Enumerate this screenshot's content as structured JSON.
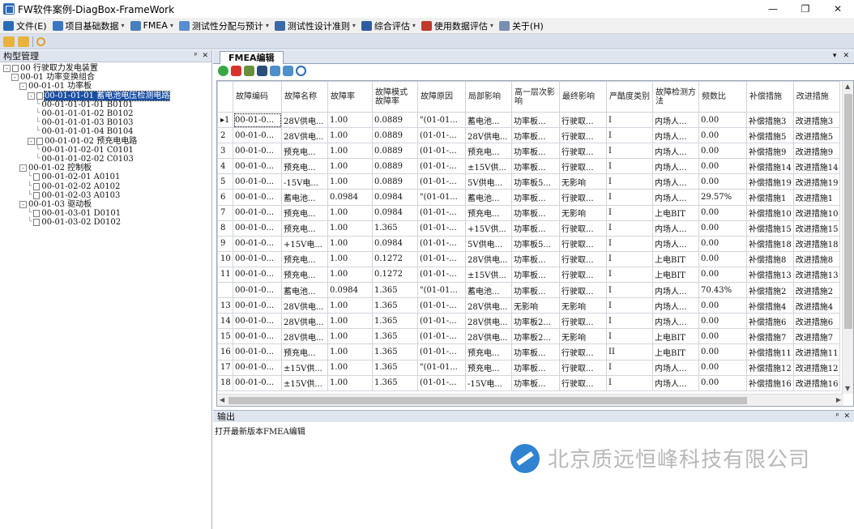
{
  "window": {
    "title": "FW软件案例-DiagBox-FrameWork",
    "controls": [
      "—",
      "❐",
      "✕"
    ]
  },
  "menu": [
    {
      "label": "文件(E)",
      "color": "#2a6bb8",
      "has_arrow": false
    },
    {
      "label": "项目基础数据",
      "color": "#3a78c2",
      "has_arrow": true
    },
    {
      "label": "FMEA",
      "color": "#4a7fbf",
      "has_arrow": true
    },
    {
      "label": "测试性分配与预计",
      "color": "#5a8ccf",
      "has_arrow": true
    },
    {
      "label": "测试性设计准则",
      "color": "#3b6aa8",
      "has_arrow": true
    },
    {
      "label": "综合评估",
      "color": "#2d5d9e",
      "has_arrow": true
    },
    {
      "label": "使用数据评估",
      "color": "#c0392b",
      "has_arrow": true
    },
    {
      "label": "关于(H)",
      "color": "#7a8fb0",
      "has_arrow": false
    }
  ],
  "left_pane": {
    "title": "构型管理",
    "tree": [
      {
        "label": "00 行驶取力发电装置",
        "level": 0,
        "toggle": "-"
      },
      {
        "label": "00-01 功率变换组合",
        "level": 1,
        "toggle": "-"
      },
      {
        "label": "00-01-01 功率板",
        "level": 2,
        "toggle": "-"
      },
      {
        "label": "00-01-01-01 蓄电池电压检测电路",
        "level": 3,
        "toggle": "-",
        "selected": true
      },
      {
        "label": "00-01-01-01-01 B0101",
        "level": 4
      },
      {
        "label": "00-01-01-01-02 B0102",
        "level": 4
      },
      {
        "label": "00-01-01-01-03 B0103",
        "level": 4
      },
      {
        "label": "00-01-01-01-04 B0104",
        "level": 4
      },
      {
        "label": "00-01-01-02 预充电电路",
        "level": 3,
        "toggle": "-"
      },
      {
        "label": "00-01-01-02-01 C0101",
        "level": 4
      },
      {
        "label": "00-01-01-02-02 C0103",
        "level": 4
      },
      {
        "label": "00-01-02 控制板",
        "level": 2,
        "toggle": "-"
      },
      {
        "label": "00-01-02-01 A0101",
        "level": 3
      },
      {
        "label": "00-01-02-02 A0102",
        "level": 3
      },
      {
        "label": "00-01-02-03 A0103",
        "level": 3
      },
      {
        "label": "00-01-03 驱动板",
        "level": 2,
        "toggle": "-"
      },
      {
        "label": "00-01-03-01 D0101",
        "level": 3
      },
      {
        "label": "00-01-03-02 D0102",
        "level": 3
      }
    ]
  },
  "editor": {
    "tab_label": "FMEA编辑",
    "columns": [
      "故障编码",
      "故障名称",
      "故障率",
      "故障模式故障率",
      "故障原因",
      "局部影响",
      "高一层次影响",
      "最终影响",
      "严酷度类别",
      "故障检测方法",
      "频数比",
      "补偿措施",
      "改进措施"
    ],
    "rows": [
      {
        "idx": "1",
        "cells": [
          "00-01-0...",
          "28V供电...",
          "1.00",
          "0.0889",
          "\"(01-01...",
          "蓄电池...",
          "功率板...",
          "行驶取...",
          "I",
          "内场人...",
          "0.00",
          "补偿措施3",
          "改进措施3"
        ]
      },
      {
        "idx": "2",
        "cells": [
          "00-01-0...",
          "28V供电...",
          "1.00",
          "0.0889",
          "(01-01-...",
          "28V供电...",
          "功率板...",
          "行驶取...",
          "I",
          "内场人...",
          "0.00",
          "补偿措施5",
          "改进措施5"
        ]
      },
      {
        "idx": "3",
        "cells": [
          "00-01-0...",
          "预充电...",
          "1.00",
          "0.0889",
          "(01-01-...",
          "预充电...",
          "功率板...",
          "行驶取...",
          "I",
          "内场人...",
          "0.00",
          "补偿措施9",
          "改进措施9"
        ]
      },
      {
        "idx": "4",
        "cells": [
          "00-01-0...",
          "预充电...",
          "1.00",
          "0.0889",
          "(01-01-...",
          "±15V供...",
          "功率板...",
          "行驶取...",
          "I",
          "内场人...",
          "0.00",
          "补偿措施14",
          "改进措施14"
        ]
      },
      {
        "idx": "5",
        "cells": [
          "00-01-0...",
          "-15V电...",
          "1.00",
          "0.0889",
          "(01-01-...",
          "5V供电...",
          "功率板5...",
          "无影响",
          "I",
          "内场人...",
          "0.00",
          "补偿措施19",
          "改进措施19"
        ]
      },
      {
        "idx": "6",
        "cells": [
          "00-01-0...",
          "蓄电池...",
          "0.0984",
          "0.0984",
          "\"(01-01...",
          "蓄电池...",
          "功率板...",
          "行驶取...",
          "I",
          "内场人...",
          "29.57%",
          "补偿措施1",
          "改进措施1"
        ]
      },
      {
        "idx": "7",
        "cells": [
          "00-01-0...",
          "预充电...",
          "1.00",
          "0.0984",
          "(01-01-...",
          "预充电...",
          "功率板...",
          "无影响",
          "I",
          "上电BIT",
          "0.00",
          "补偿措施10",
          "改进措施10"
        ]
      },
      {
        "idx": "8",
        "cells": [
          "00-01-0...",
          "预充电...",
          "1.00",
          "1.365",
          "(01-01-...",
          "+15V供...",
          "功率板...",
          "行驶取...",
          "I",
          "内场人...",
          "0.00",
          "补偿措施15",
          "改进措施15"
        ]
      },
      {
        "idx": "9",
        "cells": [
          "00-01-0...",
          "+15V电...",
          "1.00",
          "0.0984",
          "(01-01-...",
          "5V供电...",
          "功率板5...",
          "行驶取...",
          "I",
          "内场人...",
          "0.00",
          "补偿措施18",
          "改进措施18"
        ]
      },
      {
        "idx": "10",
        "cells": [
          "00-01-0...",
          "预充电...",
          "1.00",
          "0.1272",
          "(01-01-...",
          "28V供电...",
          "功率板...",
          "行驶取...",
          "I",
          "上电BIT",
          "0.00",
          "补偿措施8",
          "改进措施8"
        ]
      },
      {
        "idx": "11",
        "cells": [
          "00-01-0...",
          "预充电...",
          "1.00",
          "0.1272",
          "(01-01-...",
          "±15V供...",
          "功率板...",
          "行驶取...",
          "I",
          "上电BIT",
          "0.00",
          "补偿措施13",
          "改进措施13"
        ]
      },
      {
        "idx": "",
        "cells": [
          "00-01-0...",
          "蓄电池...",
          "0.0984",
          "1.365",
          "\"(01-01...",
          "蓄电池...",
          "功率板...",
          "行驶取...",
          "I",
          "内场人...",
          "70.43%",
          "补偿措施2",
          "改进措施2"
        ]
      },
      {
        "idx": "13",
        "cells": [
          "00-01-0...",
          "28V供电...",
          "1.00",
          "1.365",
          "(01-01-...",
          "28V供电...",
          "无影响",
          "无影响",
          "I",
          "内场人...",
          "0.00",
          "补偿措施4",
          "改进措施4"
        ]
      },
      {
        "idx": "14",
        "cells": [
          "00-01-0...",
          "28V供电...",
          "1.00",
          "1.365",
          "(01-01-...",
          "28V供电...",
          "功率板2...",
          "行驶取...",
          "I",
          "内场人...",
          "0.00",
          "补偿措施6",
          "改进措施6"
        ]
      },
      {
        "idx": "15",
        "cells": [
          "00-01-0...",
          "28V供电...",
          "1.00",
          "1.365",
          "(01-01-...",
          "28V供电...",
          "功率板2...",
          "无影响",
          "I",
          "上电BIT",
          "0.00",
          "补偿措施7",
          "改进措施7"
        ]
      },
      {
        "idx": "16",
        "cells": [
          "00-01-0...",
          "预充电...",
          "1.00",
          "1.365",
          "(01-01-...",
          "预充电...",
          "功率板...",
          "行驶取...",
          "II",
          "上电BIT",
          "0.00",
          "补偿措施11",
          "改进措施11"
        ]
      },
      {
        "idx": "17",
        "cells": [
          "00-01-0...",
          "±15V供...",
          "1.00",
          "1.365",
          "\"(01-01...",
          "预充电...",
          "功率板...",
          "行驶取...",
          "I",
          "内场人...",
          "0.00",
          "补偿措施12",
          "改进措施12"
        ]
      },
      {
        "idx": "18",
        "cells": [
          "00-01-0...",
          "±15V供...",
          "1.00",
          "1.365",
          "(01-01-...",
          "-15V电...",
          "功率板...",
          "行驶取...",
          "I",
          "内场人...",
          "0.00",
          "补偿措施16",
          "改进措施16"
        ]
      }
    ],
    "current_row_marker": "▸"
  },
  "output": {
    "title": "输出",
    "message": "打开最新版本FMEA编辑"
  },
  "watermark": {
    "text": "北京质远恒峰科技有限公司"
  }
}
